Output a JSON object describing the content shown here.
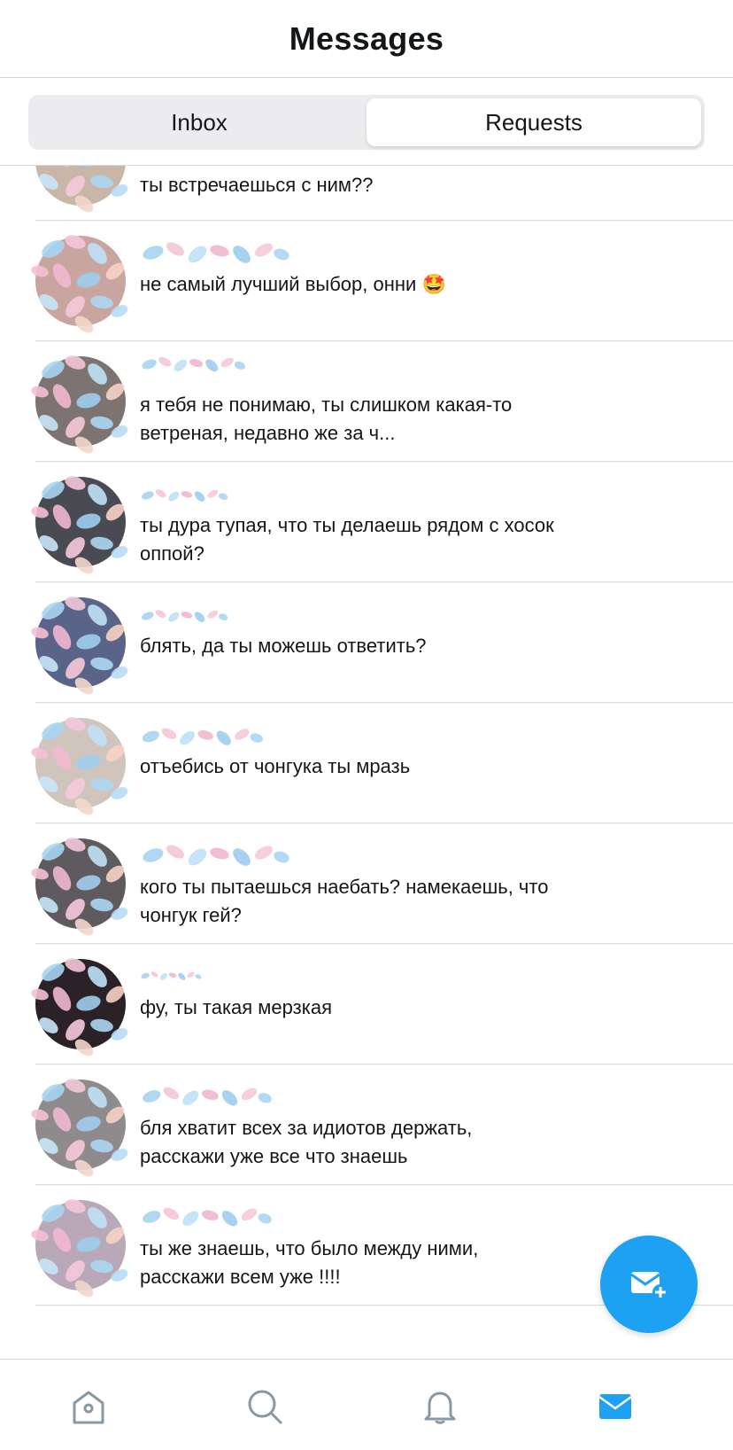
{
  "header": {
    "title": "Messages"
  },
  "tabs": [
    {
      "label": "Inbox",
      "active": false
    },
    {
      "label": "Requests",
      "active": true
    }
  ],
  "messages": [
    {
      "preview": "ты встречаешься с ним??"
    },
    {
      "preview": "не самый лучший выбор, онни 🤩"
    },
    {
      "preview": "я тебя не понимаю, ты слишком какая-то ветреная, недавно же за ч..."
    },
    {
      "preview": "ты дура тупая, что ты делаешь рядом с хосок оппой?"
    },
    {
      "preview": "блять, да ты можешь ответить?"
    },
    {
      "preview": "отъебись от чонгука ты мразь"
    },
    {
      "preview": "кого ты пытаешься наебать? намекаешь, что чонгук гей?"
    },
    {
      "preview": "фу, ты такая мерзкая"
    },
    {
      "preview": "бля хватит всех за идиотов держать, расскажи уже все что знаешь"
    },
    {
      "preview": "ты же знаешь, что было между ними, расскажи всем уже !!!!"
    }
  ],
  "fab": {
    "icon": "compose-message-icon",
    "color": "#1da1f2"
  },
  "tabbar": {
    "items": [
      {
        "icon": "home-icon",
        "active": false
      },
      {
        "icon": "search-icon",
        "active": false
      },
      {
        "icon": "bell-icon",
        "active": false
      },
      {
        "icon": "mail-icon",
        "active": true
      }
    ],
    "active_color": "#1da1f2",
    "inactive_color": "#8899a6"
  }
}
